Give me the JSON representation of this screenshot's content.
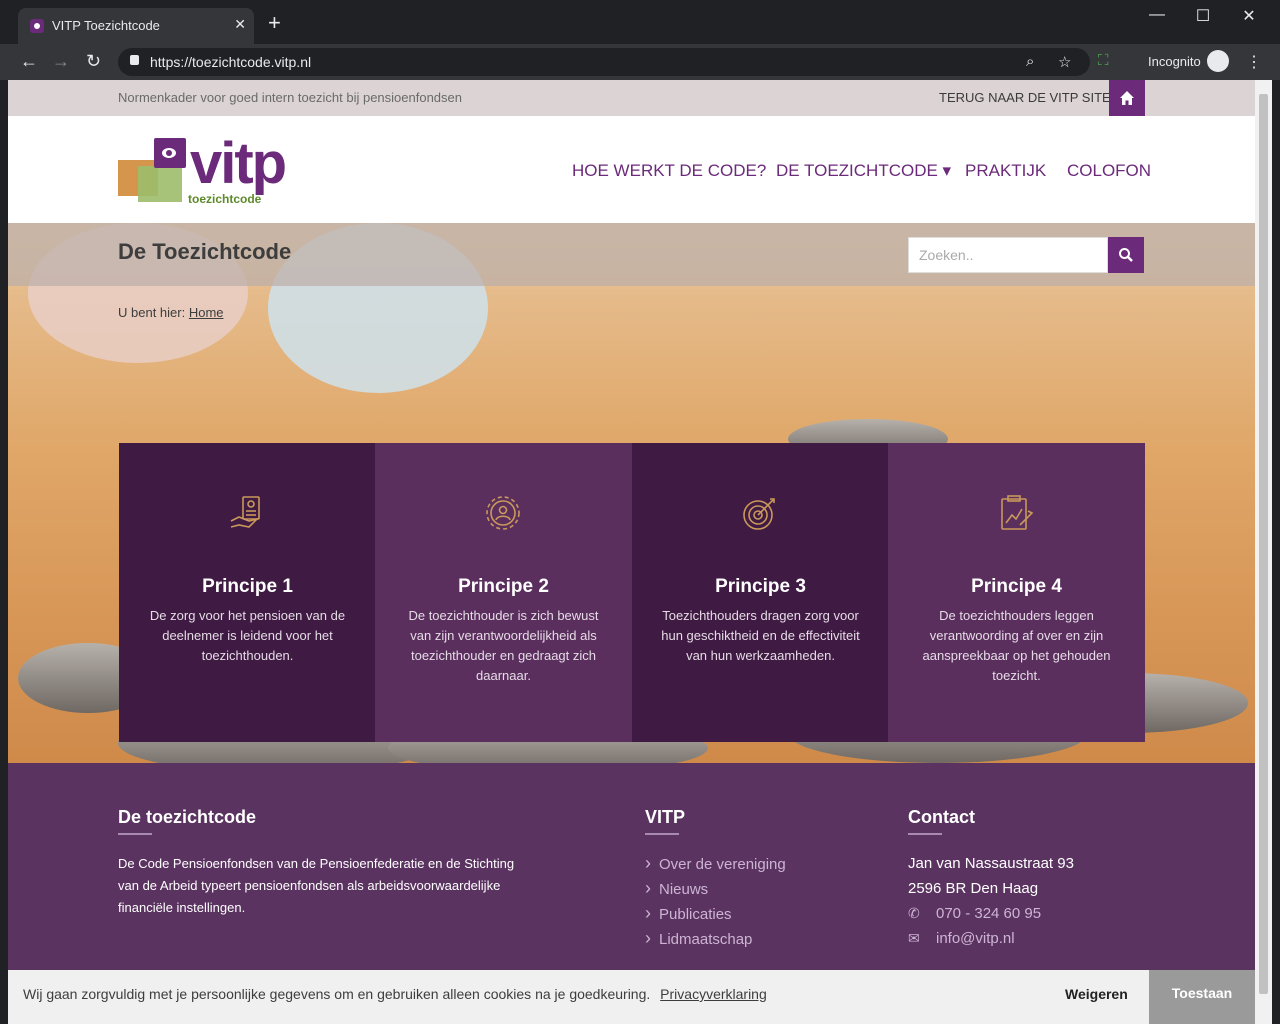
{
  "browser": {
    "tab_title": "VITP Toezichtcode",
    "url": "https://toezichtcode.vitp.nl",
    "profile_label": "Incognito"
  },
  "topbar": {
    "tagline": "Normenkader voor goed intern toezicht bij pensioenfondsen",
    "back_link": "TERUG NAAR DE VITP SITE"
  },
  "logo": {
    "word": "vitp",
    "sub": "toezichtcode"
  },
  "nav": [
    {
      "label": "HOE WERKT DE CODE?"
    },
    {
      "label": "DE TOEZICHTCODE ▾"
    },
    {
      "label": "PRAKTIJK"
    },
    {
      "label": "COLOFON"
    }
  ],
  "page": {
    "title": "De Toezichtcode",
    "search_placeholder": "Zoeken..",
    "breadcrumb_prefix": "U bent hier:",
    "breadcrumb_link": "Home"
  },
  "principles": [
    {
      "title": "Principe 1",
      "text": "De zorg voor het pensioen van de deelnemer is leidend voor het toezichthouden.",
      "icon": "document-hand-icon"
    },
    {
      "title": "Principe 2",
      "text": "De toezichthouder is zich bewust van zijn verantwoordelijkheid als toezichthouder en gedraagt zich daarnaar.",
      "icon": "gear-person-icon"
    },
    {
      "title": "Principe 3",
      "text": "Toezichthouders dragen zorg voor hun geschiktheid en de effectiviteit van hun werkzaamheden.",
      "icon": "target-icon"
    },
    {
      "title": "Principe 4",
      "text": "De toezichthouders leggen verantwoording af over en zijn aanspreekbaar op het gehouden toezicht.",
      "icon": "clipboard-chart-icon"
    }
  ],
  "footer": {
    "col1": {
      "title": "De toezichtcode",
      "text": "De Code Pensioenfondsen van de Pensioenfederatie en de Stichting van de Arbeid typeert pensioenfondsen als arbeidsvoorwaardelijke financiële instellingen."
    },
    "col2": {
      "title": "VITP",
      "links": [
        "Over de vereniging",
        "Nieuws",
        "Publicaties",
        "Lidmaatschap"
      ]
    },
    "col3": {
      "title": "Contact",
      "address_line1": "Jan van Nassaustraat 93",
      "address_line2": "2596 BR  Den Haag",
      "phone": "070 - 324 60 95",
      "email": "info@vitp.nl"
    }
  },
  "cookie": {
    "text": "Wij gaan zorgvuldig met je persoonlijke gegevens om en gebruiken alleen cookies na je goedkeuring.",
    "link": "Privacyverklaring",
    "deny": "Weigeren",
    "allow": "Toestaan"
  },
  "colors": {
    "brand_purple": "#6b2a7a",
    "card_dark": "#3f1a43",
    "card_light": "#5a2f5e",
    "footer": "#5a3360"
  }
}
